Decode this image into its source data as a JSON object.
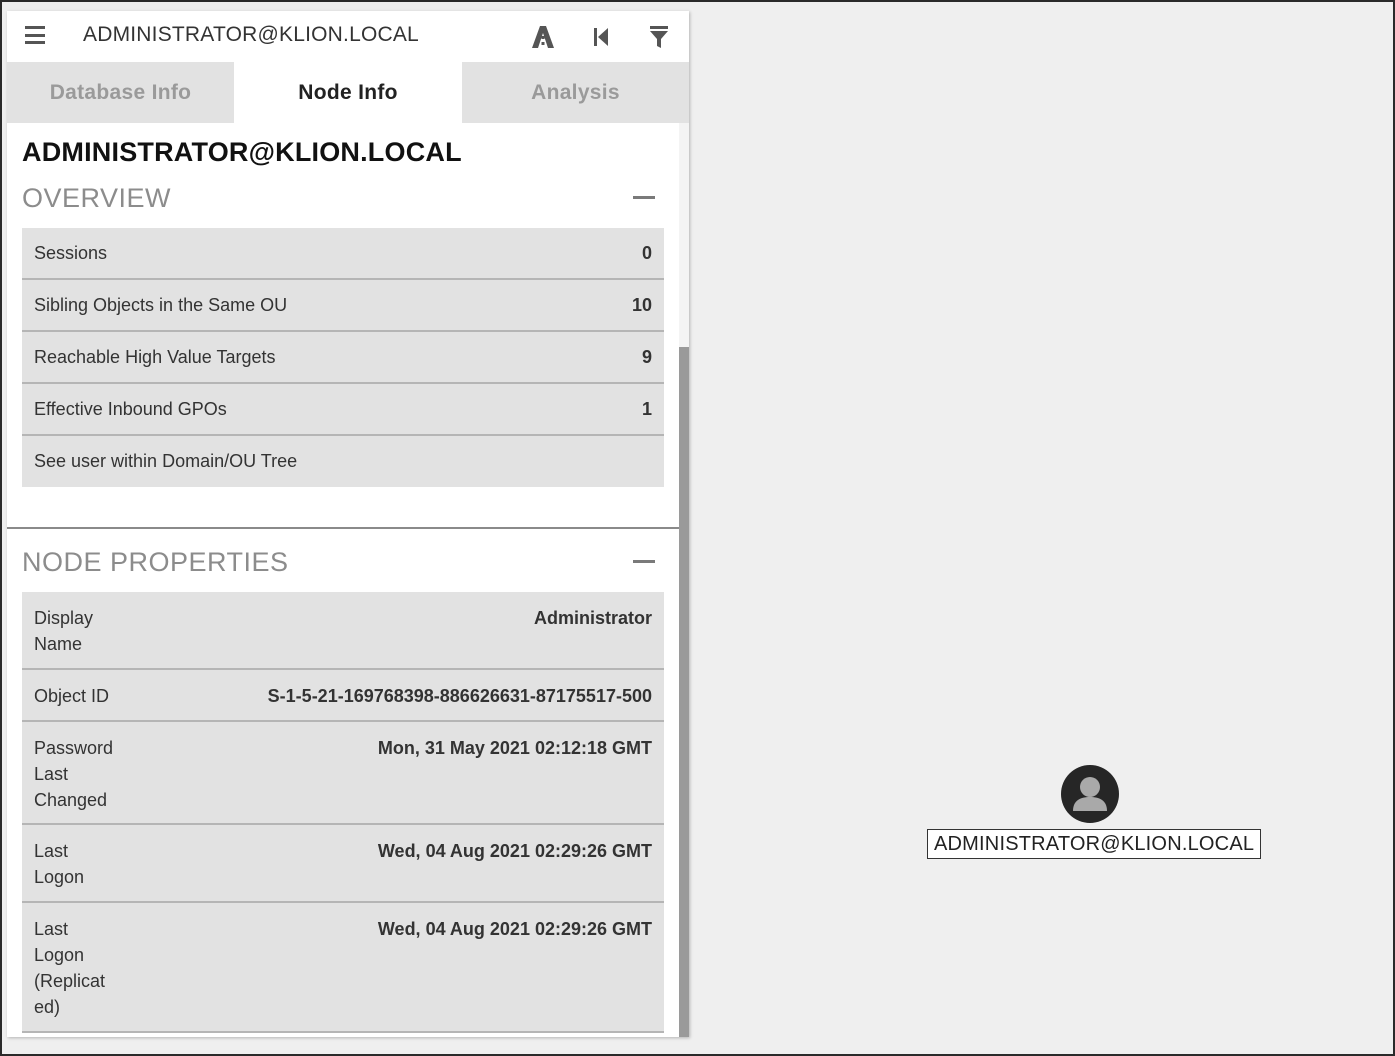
{
  "header": {
    "search_text": "ADMINISTRATOR@KLION.LOCAL",
    "icons": [
      "menu-icon",
      "pathfinding-icon",
      "back-icon",
      "filter-icon"
    ]
  },
  "tabs": [
    {
      "label": "Database Info",
      "active": false
    },
    {
      "label": "Node Info",
      "active": true
    },
    {
      "label": "Analysis",
      "active": false
    }
  ],
  "node": {
    "title": "ADMINISTRATOR@KLION.LOCAL"
  },
  "overview": {
    "heading": "OVERVIEW",
    "rows": [
      {
        "label": "Sessions",
        "value": "0"
      },
      {
        "label": "Sibling Objects in the Same OU",
        "value": "10"
      },
      {
        "label": "Reachable High Value Targets",
        "value": "9"
      },
      {
        "label": "Effective Inbound GPOs",
        "value": "1"
      },
      {
        "label": "See user within Domain/OU Tree",
        "value": ""
      }
    ]
  },
  "node_properties": {
    "heading": "NODE PROPERTIES",
    "rows": [
      {
        "label_lines": [
          "Display",
          "Name"
        ],
        "value": "Administrator"
      },
      {
        "label_lines": [
          "Object ID"
        ],
        "value": "S-1-5-21-169768398-886626631-87175517-500"
      },
      {
        "label_lines": [
          "Password",
          "Last",
          "Changed"
        ],
        "value": "Mon, 31 May 2021 02:12:18 GMT"
      },
      {
        "label_lines": [
          "Last",
          "Logon"
        ],
        "value": "Wed, 04 Aug 2021 02:29:26 GMT"
      },
      {
        "label_lines": [
          "Last",
          "Logon",
          "(Replicat",
          "ed)"
        ],
        "value": "Wed, 04 Aug 2021 02:29:26 GMT"
      }
    ]
  },
  "graph": {
    "node_label": "ADMINISTRATOR@KLION.LOCAL",
    "node_icon": "user-icon"
  },
  "colors": {
    "background": "#efefef",
    "tab_inactive": "#e2e2e2",
    "row_background": "#e2e2e2",
    "node_fill": "#262626"
  }
}
